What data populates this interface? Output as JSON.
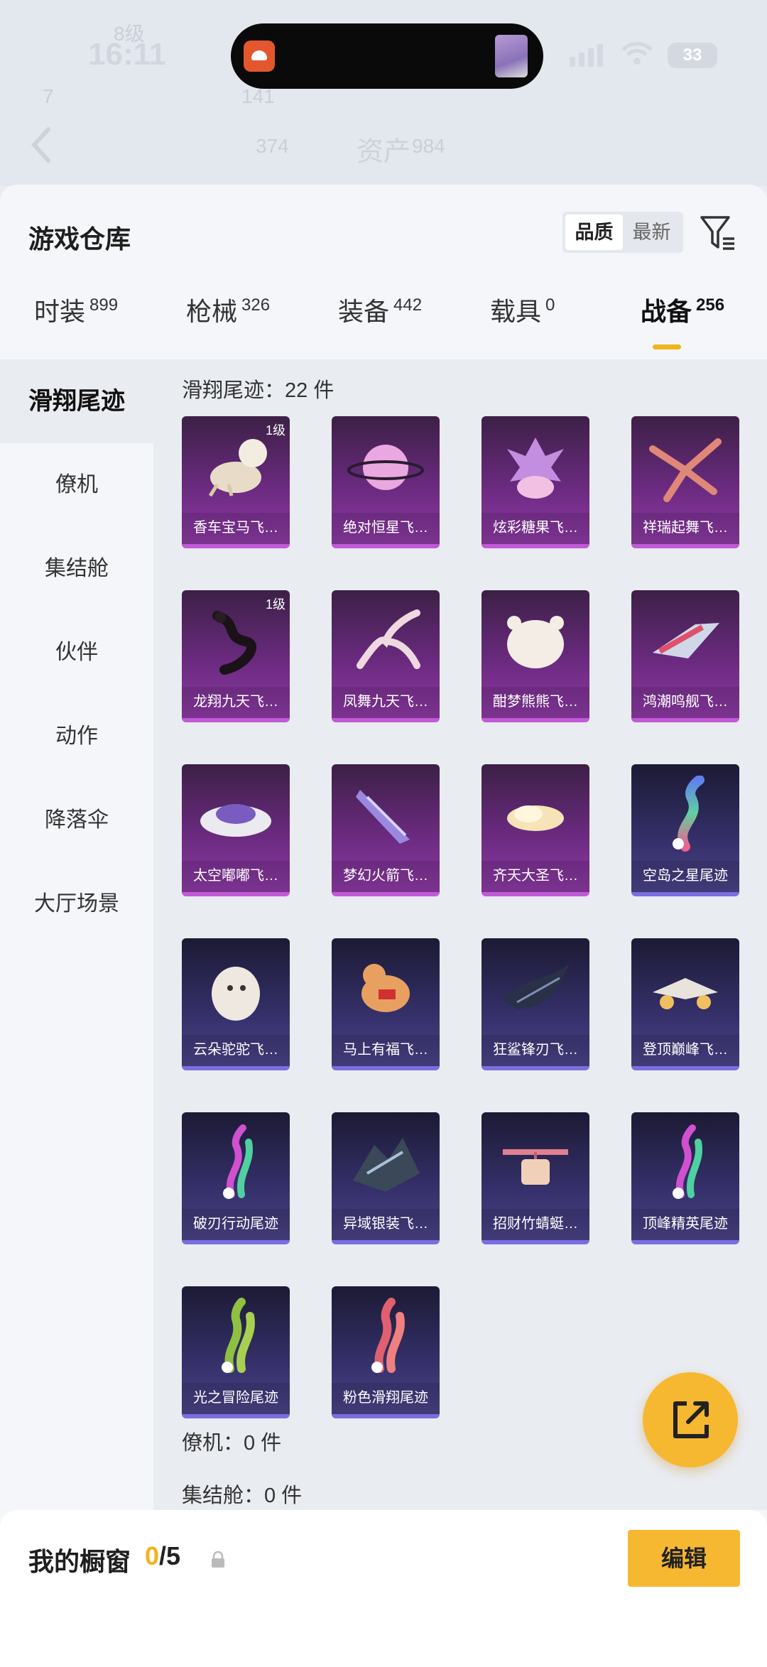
{
  "status": {
    "time": "16:11",
    "battery": "33"
  },
  "header": {
    "title": "资产"
  },
  "panel": {
    "title": "游戏仓库",
    "sort": [
      "品质",
      "最新"
    ],
    "tabs": [
      {
        "label": "时装",
        "count": "899"
      },
      {
        "label": "枪械",
        "count": "326"
      },
      {
        "label": "装备",
        "count": "442"
      },
      {
        "label": "载具",
        "count": "0"
      },
      {
        "label": "战备",
        "count": "256"
      }
    ]
  },
  "sidebar": [
    "滑翔尾迹",
    "僚机",
    "集结舱",
    "伙伴",
    "动作",
    "降落伞",
    "大厅场景"
  ],
  "sections": {
    "glide": "滑翔尾迹：22 件",
    "wingman": "僚机：0 件",
    "assembly": "集结舱：0 件"
  },
  "items": [
    {
      "name": "香车宝马飞…",
      "level": "1级",
      "rarity": "purple",
      "icon": "horse-carriage-icon"
    },
    {
      "name": "绝对恒星飞…",
      "rarity": "purple",
      "icon": "planet-icon"
    },
    {
      "name": "炫彩糖果飞…",
      "rarity": "purple",
      "icon": "candy-icon"
    },
    {
      "name": "祥瑞起舞飞…",
      "rarity": "purple",
      "icon": "phoenix-icon"
    },
    {
      "name": "龙翔九天飞…",
      "level": "1级",
      "rarity": "purple",
      "icon": "dragon-icon"
    },
    {
      "name": "凤舞九天飞…",
      "rarity": "purple",
      "icon": "feather-wings-icon"
    },
    {
      "name": "酣梦熊熊飞…",
      "rarity": "purple",
      "icon": "bear-icon"
    },
    {
      "name": "鸿潮鸣舰飞…",
      "rarity": "purple",
      "icon": "airship-icon"
    },
    {
      "name": "太空嘟嘟飞…",
      "rarity": "purple",
      "icon": "ufo-icon"
    },
    {
      "name": "梦幻火箭飞…",
      "rarity": "purple",
      "icon": "rocket-icon"
    },
    {
      "name": "齐天大圣飞…",
      "rarity": "purple",
      "icon": "cloud-icon"
    },
    {
      "name": "空岛之星尾迹",
      "rarity": "blue",
      "icon": "rainbow-smoke-icon"
    },
    {
      "name": "云朵驼驼飞…",
      "rarity": "blue",
      "icon": "alpaca-icon"
    },
    {
      "name": "马上有福飞…",
      "rarity": "blue",
      "icon": "toy-horse-icon"
    },
    {
      "name": "狂鲨锋刃飞…",
      "rarity": "blue",
      "icon": "shark-icon"
    },
    {
      "name": "登顶巅峰飞…",
      "rarity": "blue",
      "icon": "jet-icon"
    },
    {
      "name": "破刃行动尾迹",
      "rarity": "blue",
      "icon": "smoke-trail-icon"
    },
    {
      "name": "异域银装飞…",
      "rarity": "blue",
      "icon": "mecha-wing-icon"
    },
    {
      "name": "招财竹蜻蜓…",
      "rarity": "blue",
      "icon": "copter-icon"
    },
    {
      "name": "顶峰精英尾迹",
      "rarity": "blue",
      "icon": "smoke-trail-icon"
    },
    {
      "name": "光之冒险尾迹",
      "rarity": "blue",
      "icon": "green-smoke-icon"
    },
    {
      "name": "粉色滑翔尾迹",
      "rarity": "blue",
      "icon": "pink-smoke-icon"
    }
  ],
  "showcase": {
    "label": "我的橱窗",
    "current": "0",
    "total": "/5"
  },
  "edit_label": "编辑",
  "colors": {
    "accent": "#f6b731",
    "purple": "#8d3aa4",
    "blue": "#4b4388"
  }
}
